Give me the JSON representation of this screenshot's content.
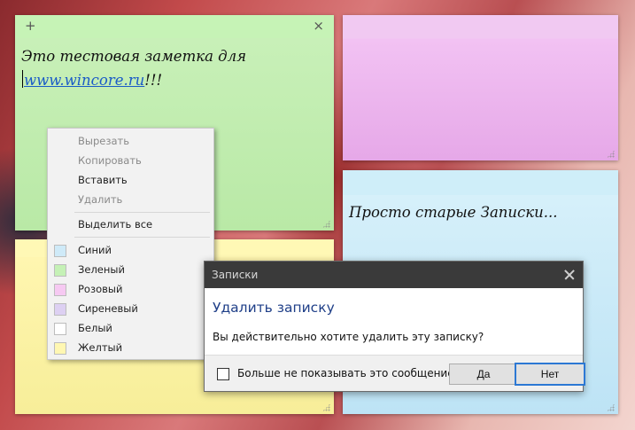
{
  "notes": {
    "green": {
      "add_glyph": "+",
      "close_glyph": "×",
      "text_line1": "Это тестовая заметка для",
      "link": "www.wincore.ru",
      "link_suffix": "!!!",
      "color": "#c6f3b6"
    },
    "pink": {
      "color": "#f1c9f2"
    },
    "blue": {
      "text": "Просто старые Записки...",
      "color": "#cfeef9"
    },
    "yellow": {
      "color": "#fff8b5"
    }
  },
  "context_menu": {
    "items": [
      {
        "label": "Вырезать",
        "disabled": true
      },
      {
        "label": "Копировать",
        "disabled": true
      },
      {
        "label": "Вставить",
        "disabled": false
      },
      {
        "label": "Удалить",
        "disabled": true
      }
    ],
    "select_all": "Выделить все",
    "colors": [
      {
        "label": "Синий",
        "swatch": "#cfeaf8"
      },
      {
        "label": "Зеленый",
        "swatch": "#c5f1b6"
      },
      {
        "label": "Розовый",
        "swatch": "#f6c9f2"
      },
      {
        "label": "Сиреневый",
        "swatch": "#ddd0f2"
      },
      {
        "label": "Белый",
        "swatch": "#ffffff"
      },
      {
        "label": "Желтый",
        "swatch": "#fff7b2"
      }
    ]
  },
  "dialog": {
    "title": "Записки",
    "heading": "Удалить записку",
    "message": "Вы действительно хотите удалить эту записку?",
    "checkbox_label": "Больше не показывать это сообщение",
    "yes_label": "Да",
    "no_label": "Нет",
    "accent": "#2c78d4"
  }
}
